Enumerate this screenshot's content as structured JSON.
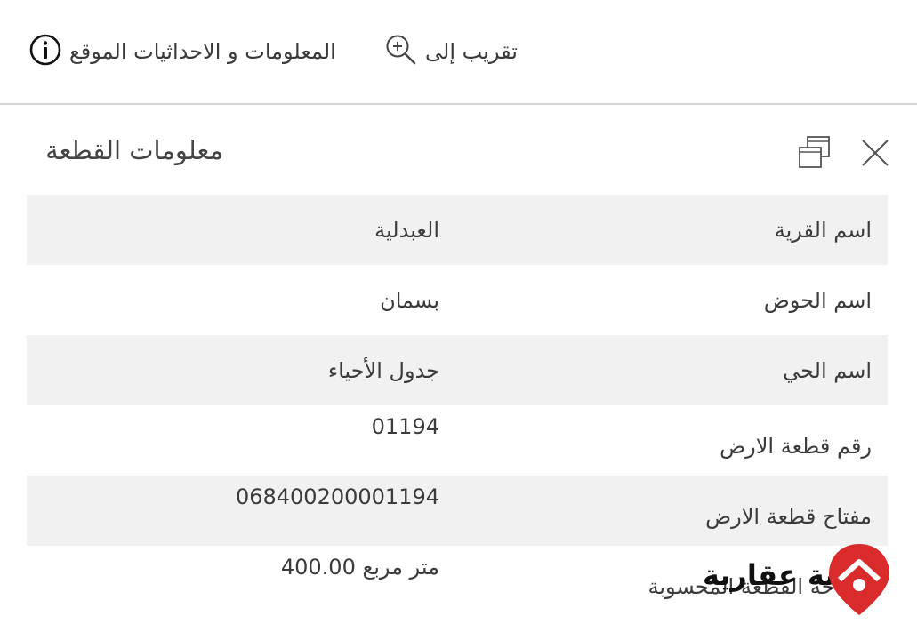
{
  "toolbar": {
    "zoom_label": "تقريب إلى",
    "info_label": "المعلومات و الاحداثيات الموقع"
  },
  "panel": {
    "title": "معلومات القطعة"
  },
  "rows": [
    {
      "key": "اسم القرية",
      "value": "العبدلية"
    },
    {
      "key": "اسم الحوض",
      "value": "بسمان"
    },
    {
      "key": "اسم الحي",
      "value": "جدول الأحياء"
    },
    {
      "key": "رقم قطعة الارض",
      "value": "01194"
    },
    {
      "key": "مفتاح قطعة الارض",
      "value": "068400200001194"
    },
    {
      "key": "مساحة القطعة المحسوبة",
      "value": "400.00 متر مربع"
    }
  ],
  "logo": {
    "text": "بوابة عقارية",
    "color": "#d92b2b"
  },
  "icons": {
    "zoom": "zoom-in-icon",
    "info": "info-icon",
    "close": "close-icon",
    "copy": "copy-windows-icon"
  }
}
